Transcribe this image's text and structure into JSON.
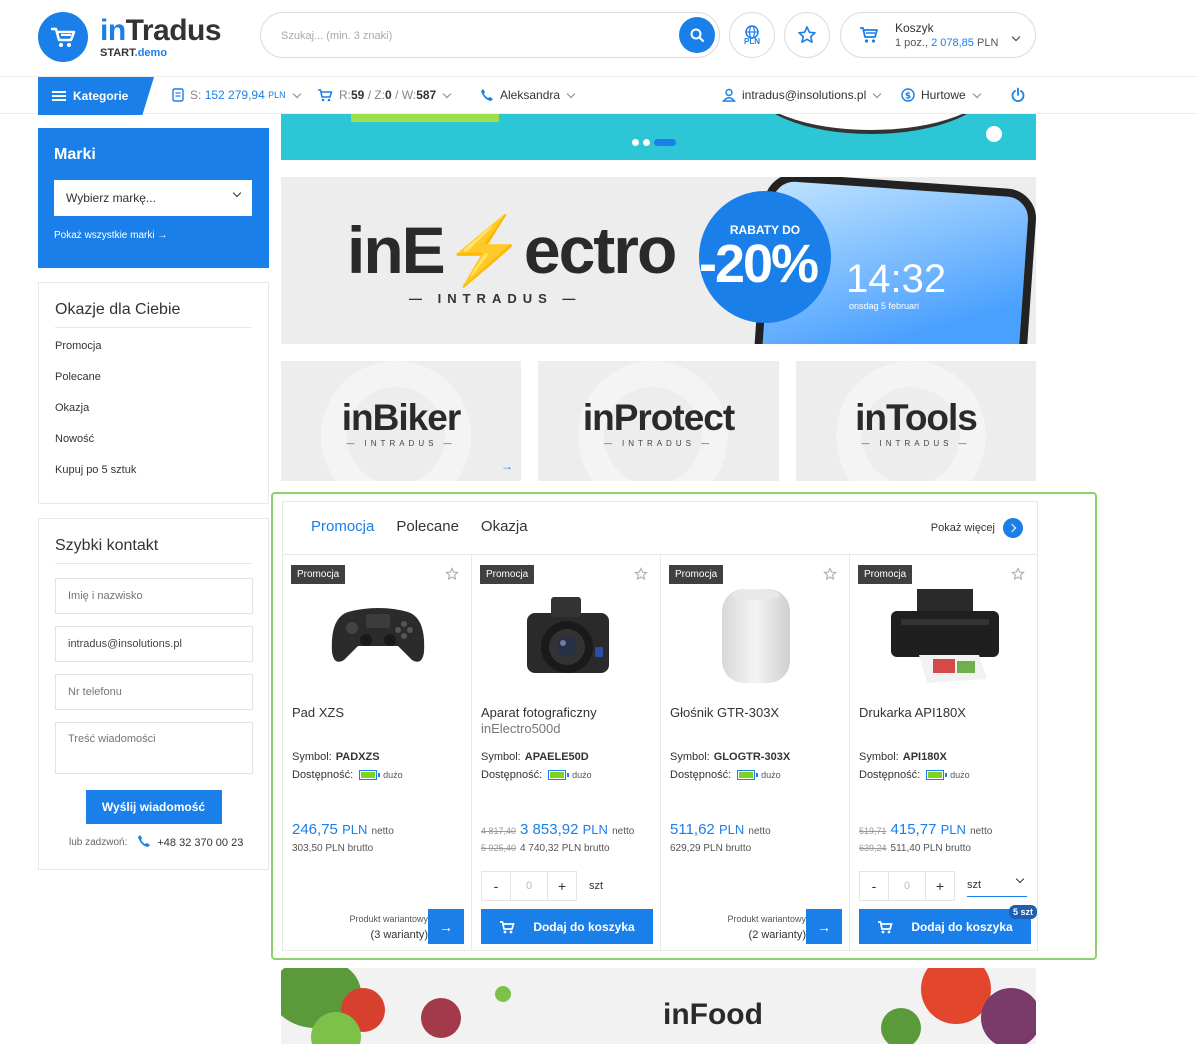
{
  "header": {
    "logo_name_a": "in",
    "logo_name_b": "Tradus",
    "logo_sub_a": "START",
    "logo_sub_b": ".demo",
    "search_placeholder": "Szukaj... (min. 3 znaki)",
    "currency_label": "PLN",
    "cart_title": "Koszyk",
    "cart_count": "1 poz.,",
    "cart_sum": "2 078,85",
    "cart_currency": "PLN"
  },
  "nav": {
    "categories": "Kategorie",
    "saldo_prefix": "S:",
    "saldo_value": "152 279,94",
    "saldo_cur": "PLN",
    "orders_r_label": "R:",
    "orders_r": "59",
    "orders_z_label": "/ Z:",
    "orders_z": "0",
    "orders_w_label": "/ W:",
    "orders_w": "587",
    "contact_person": "Aleksandra",
    "user_email": "intradus@insolutions.pl",
    "price_level": "Hurtowe"
  },
  "sidebar": {
    "brands_title": "Marki",
    "brands_select": "Wybierz markę...",
    "brands_all": "Pokaż wszystkie marki",
    "deals_title": "Okazje dla Ciebie",
    "deals": [
      "Promocja",
      "Polecane",
      "Okazja",
      "Nowość",
      "Kupuj po 5 sztuk"
    ],
    "contact_title": "Szybki kontakt",
    "name_placeholder": "Imię i nazwisko",
    "email_value": "intradus@insolutions.pl",
    "phone_placeholder": "Nr telefonu",
    "message_placeholder": "Treść wiadomości",
    "send_label": "Wyślij wiadomość",
    "call_label": "lub zadzwoń:",
    "call_number": "+48 32 370 00 23"
  },
  "banners": {
    "electro_a": "inE",
    "electro_bolt": "⚡",
    "electro_b": "ectro",
    "electro_sub": "— INTRADUS —",
    "rabat_title": "RABATY DO",
    "rabat_value": "-20%",
    "clock": "14:32",
    "clock_sub": "onsdag 5 februari",
    "tiles": [
      {
        "name": "inBiker",
        "sub": "— INTRADUS —"
      },
      {
        "name": "inProtect",
        "sub": "— INTRADUS —"
      },
      {
        "name": "inTools",
        "sub": "— INTRADUS —"
      }
    ],
    "food": "inFood"
  },
  "products": {
    "tabs": [
      "Promocja",
      "Polecane",
      "Okazja"
    ],
    "more": "Pokaż więcej",
    "badge": "Promocja",
    "symbol_label": "Symbol:",
    "avail_label": "Dostępność:",
    "avail_value": "dużo",
    "netto": "netto",
    "brutto": "PLN brutto",
    "currency": "PLN",
    "variant_label": "Produkt wariantowy",
    "add_label": "Dodaj do koszyka",
    "qty_value": "0",
    "unit": "szt",
    "items": [
      {
        "name": "Pad XZS",
        "sub": "",
        "symbol": "PADXZS",
        "price": "246,75",
        "old_price": "",
        "brutto": "303,50",
        "old_brutto": "",
        "variants": "(3 warianty)"
      },
      {
        "name": "Aparat fotograficzny",
        "sub": "inElectro500d",
        "symbol": "APAELE50D",
        "price": "3 853,92",
        "old_price": "4 817,40",
        "brutto": "4 740,32",
        "old_brutto": "5 925,40",
        "variants": ""
      },
      {
        "name": "Głośnik GTR-303X",
        "sub": "",
        "symbol": "GLOGTR-303X",
        "price": "511,62",
        "old_price": "",
        "brutto": "629,29",
        "old_brutto": "",
        "variants": "(2 warianty)"
      },
      {
        "name": "Drukarka API180X",
        "sub": "",
        "symbol": "API180X",
        "price": "415,77",
        "old_price": "519,71",
        "brutto": "511,40",
        "old_brutto": "639,24",
        "variants": "",
        "cart_badge": "5 szt"
      }
    ]
  },
  "colors": {
    "accent": "#1a7fe8",
    "highlight_border": "#8cd16e",
    "badge_bg": "#404040"
  }
}
